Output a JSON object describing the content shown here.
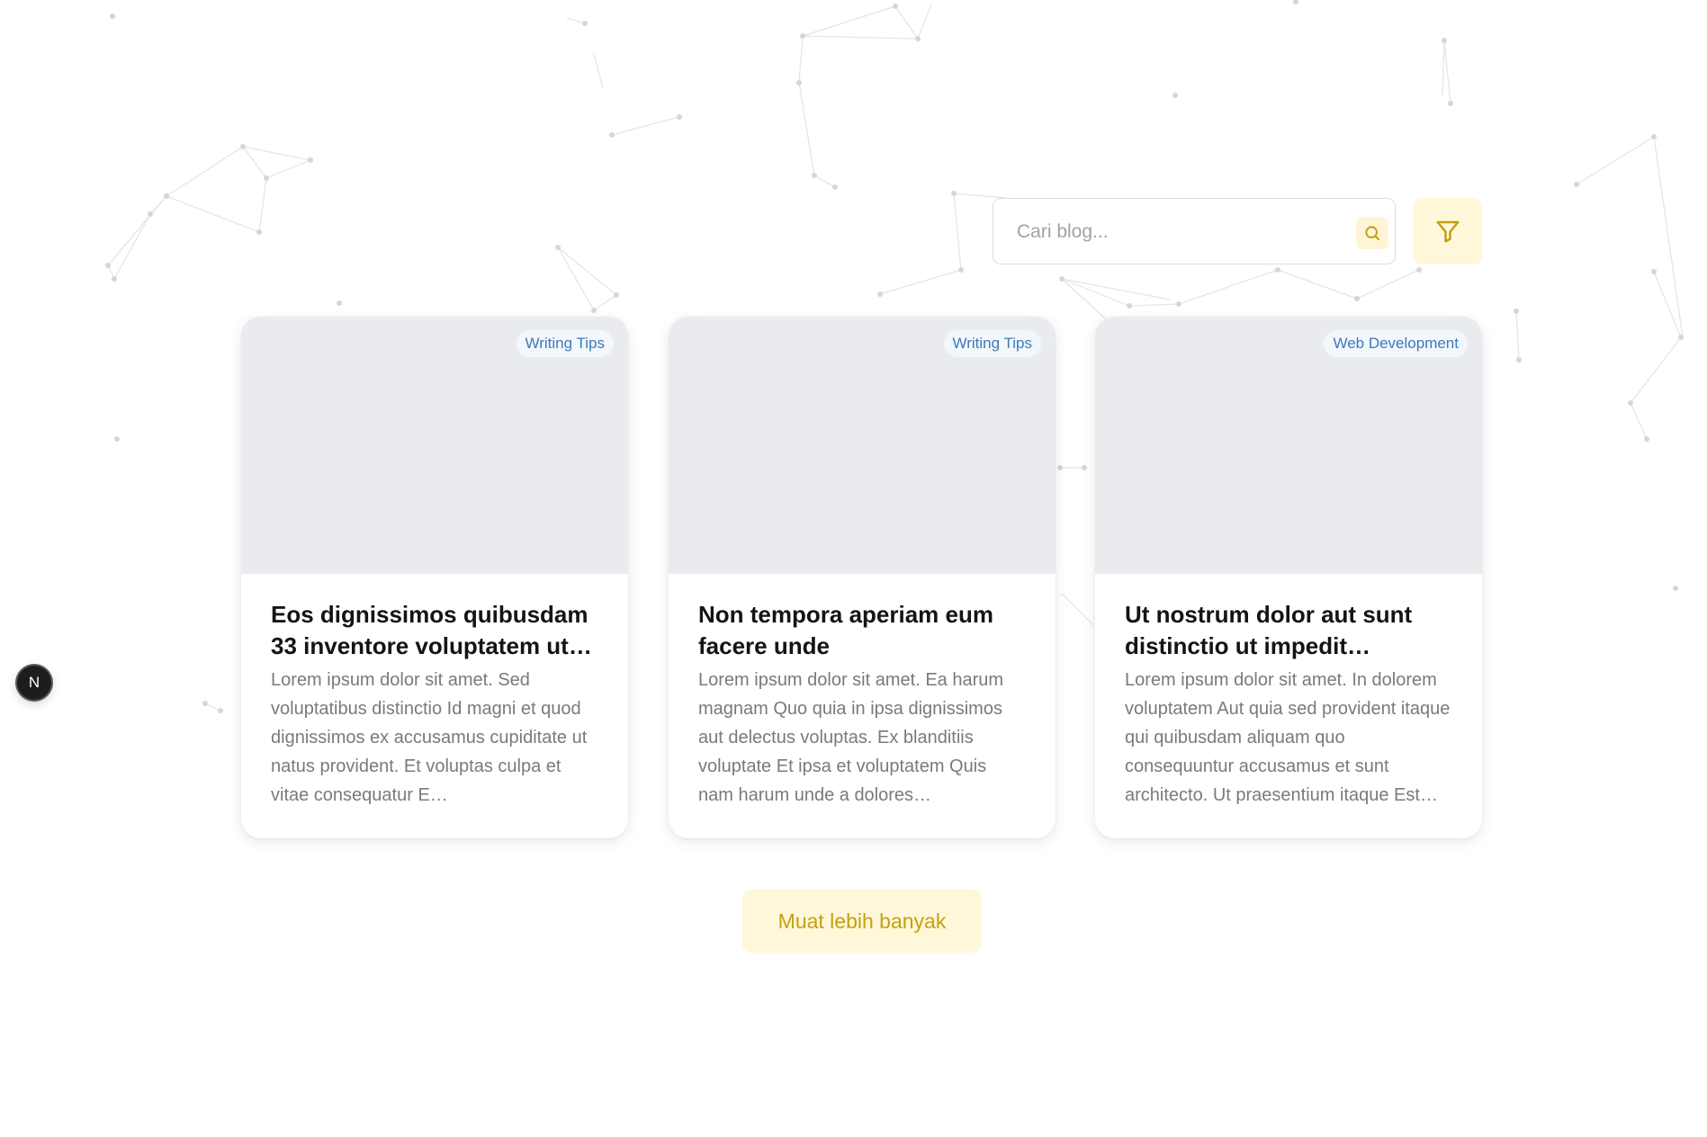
{
  "search": {
    "placeholder": "Cari blog...",
    "value": "",
    "search_icon": "search-icon",
    "filter_icon": "filter-icon"
  },
  "posts": [
    {
      "tag": "Writing Tips",
      "title": "Eos dignissimos quibusdam 33 inventore voluptatem ut…",
      "excerpt": "Lorem ipsum dolor sit amet. Sed voluptatibus distinctio Id magni et quod dignissimos ex accusamus cupiditate ut natus provident. Et voluptas culpa et vitae consequatur E…"
    },
    {
      "tag": "Writing Tips",
      "title": "Non tempora aperiam eum facere unde",
      "excerpt": "Lorem ipsum dolor sit amet. Ea harum magnam Quo quia in ipsa dignissimos aut delectus voluptas. Ex blanditiis voluptate Et ipsa et voluptatem Quis nam harum unde a dolores…"
    },
    {
      "tag": "Web Development",
      "title": "Ut nostrum dolor aut sunt distinctio ut impedit…",
      "excerpt": "Lorem ipsum dolor sit amet. In dolorem voluptatem Aut quia sed provident itaque qui quibusdam aliquam quo consequuntur accusamus et sunt architecto. Ut praesentium itaque Est…"
    }
  ],
  "load_more_label": "Muat lebih banyak",
  "floating_badge": "N",
  "colors": {
    "accent": "#c4a112",
    "accent_bg": "#fff7d9",
    "tag_text": "#3d7ab7",
    "tag_bg": "#f2f7fc",
    "image_placeholder": "#e9ebee"
  }
}
